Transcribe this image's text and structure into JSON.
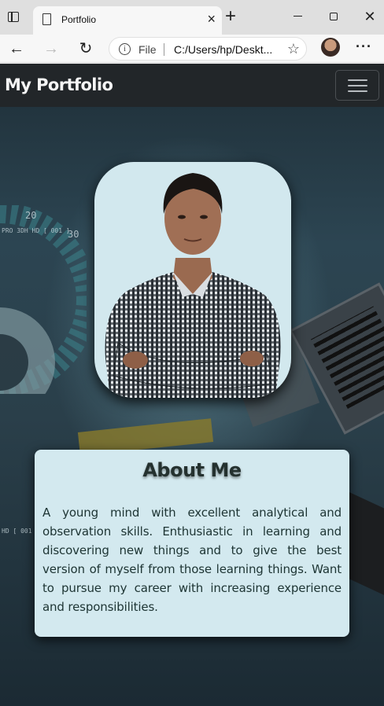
{
  "browser": {
    "tab_title": "Portfolio",
    "url_scheme": "File",
    "url": "C:/Users/hp/Deskt..."
  },
  "navbar": {
    "brand": "My Portfolio"
  },
  "about": {
    "title": "About Me",
    "text": "A young mind with excellent analytical and observation skills. Enthusiastic in learning and discovering new things and to give the best version of myself from those learning things. Want to pursue my career with increasing experience and responsibilities."
  },
  "background_text": [
    "PRO 3DH HD [ 001 ]",
    "20",
    "30",
    "HD [ 001 ]"
  ],
  "colors": {
    "navbar": "#222629",
    "card": "#d3e9ef",
    "text": "#1d3433"
  }
}
